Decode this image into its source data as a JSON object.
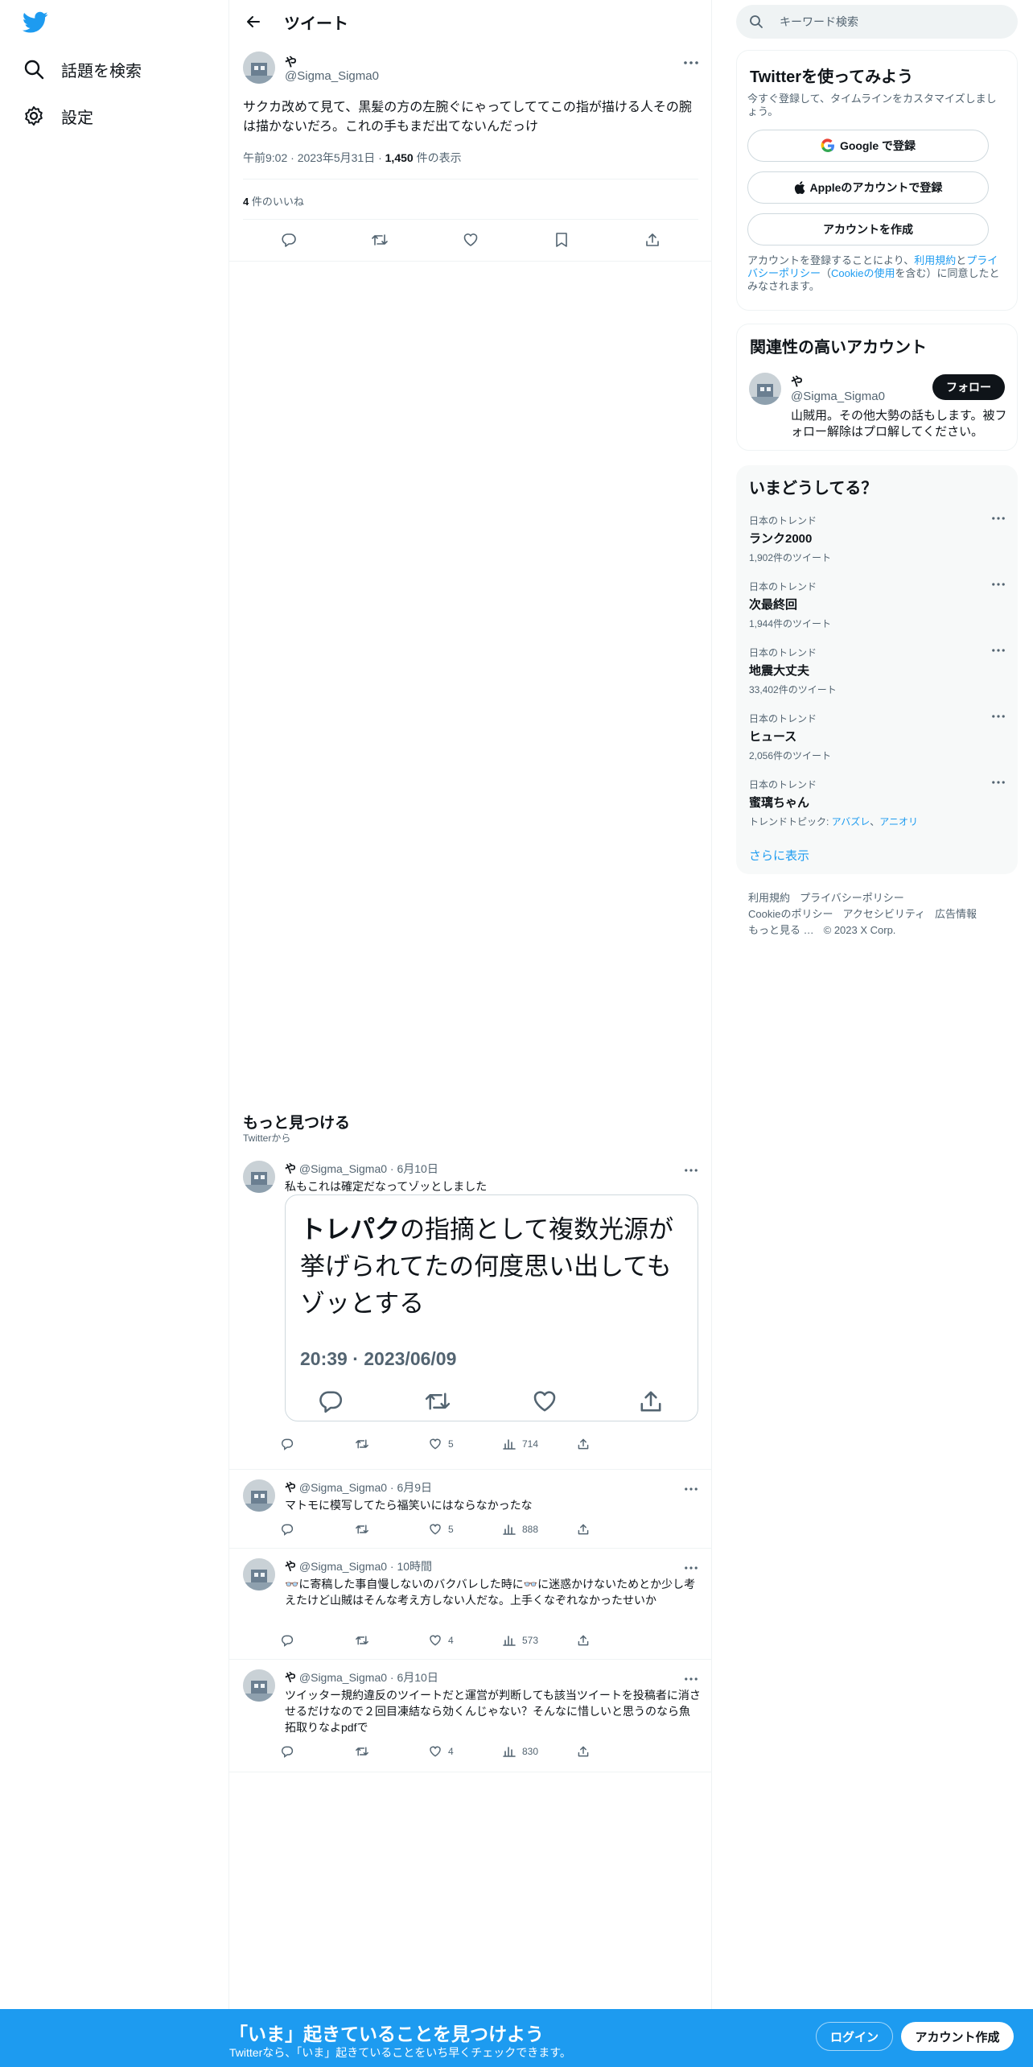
{
  "colors": {
    "brand": "#1d9bf0",
    "text": "#0f1419",
    "muted": "#536471",
    "border": "#eff3f4"
  },
  "nav": {
    "logo_icon": "twitter-bird-icon",
    "items": [
      {
        "icon": "search-icon",
        "label": "話題を検索"
      },
      {
        "icon": "gear-icon",
        "label": "設定"
      }
    ]
  },
  "header": {
    "title": "ツイート"
  },
  "main_tweet": {
    "name": "や",
    "handle": "@Sigma_Sigma0",
    "text": "サクカ改めて見て、黒髪の方の左腕ぐにゃってしててこの指が描ける人その腕は描かないだろ。これの手もまだ出てないんだっけ",
    "time": "午前9:02 · 2023年5月31日 · ",
    "views": "1,450",
    "views_label": " 件の表示",
    "likes": "4",
    "likes_label": " 件のいいね"
  },
  "more": {
    "title": "もっと見つける",
    "subtitle": "Twitterから"
  },
  "tweets": [
    {
      "name": "や",
      "meta": " @Sigma_Sigma0 · 6月10日",
      "text": "私もこれは確定だなってゾッとしました",
      "quote": {
        "bold": "トレパク",
        "text": "の指摘として複数光源が挙げられてたの何度思い出してもゾッとする",
        "time": "20:39 · 2023/06/09"
      },
      "likes": "5",
      "views": "714"
    },
    {
      "name": "や",
      "meta": " @Sigma_Sigma0 · 6月9日",
      "text": "マトモに模写してたら福笑いにはならなかったな",
      "likes": "5",
      "views": "888"
    },
    {
      "name": "や",
      "meta": " @Sigma_Sigma0 · 10時間",
      "text": "👓に寄稿した事自慢しないのバクバレした時に👓に迷惑かけないためとか少し考えたけど山賊はそんな考え方しない人だな。上手くなぞれなかったせいか",
      "likes": "4",
      "views": "573"
    },
    {
      "name": "や",
      "meta": " @Sigma_Sigma0 · 6月10日",
      "text": "ツイッター規約違反のツイートだと運営が判断しても該当ツイートを投稿者に消させるだけなので２回目凍結なら効くんじゃない？そんなに惜しいと思うのなら魚拓取りなよpdfで",
      "likes": "4",
      "views": "830"
    }
  ],
  "search": {
    "placeholder": "キーワード検索"
  },
  "signup_card": {
    "title": "Twitterを使ってみよう",
    "subtitle": "今すぐ登録して、タイムラインをカスタマイズしましょう。",
    "google": "Google で登録",
    "apple": "Appleのアカウントで登録",
    "create": "アカウントを作成",
    "legal_1": "アカウントを登録することにより、",
    "legal_terms": "利用規約",
    "legal_2": "と",
    "legal_privacy": "プライバシーポリシー",
    "legal_3": "（",
    "legal_cookie": "Cookieの使用",
    "legal_4": "を含む）に同意したとみなされます。"
  },
  "related": {
    "title": "関連性の高いアカウント",
    "name": "や",
    "handle": "@Sigma_Sigma0",
    "follow": "フォロー",
    "bio": "山賊用。その他大勢の話もします。被フォロー解除はプロ解してください。"
  },
  "trends": {
    "title": "いまどうしてる？",
    "items": [
      {
        "context": "日本のトレンド",
        "name": "ランク2000",
        "count": "1,902件のツイート"
      },
      {
        "context": "日本のトレンド",
        "name": "次最終回",
        "count": "1,944件のツイート"
      },
      {
        "context": "日本のトレンド",
        "name": "地震大丈夫",
        "count": "33,402件のツイート"
      },
      {
        "context": "日本のトレンド",
        "name": "ヒュース",
        "count": "2,056件のツイート"
      },
      {
        "context": "日本のトレンド",
        "name": "蜜璃ちゃん",
        "topic_label": "トレンドトピック: ",
        "topic_1": "アバズレ",
        "topic_sep": "、",
        "topic_2": "アニオリ"
      }
    ],
    "show_more": "さらに表示"
  },
  "footer": {
    "links": [
      "利用規約",
      "プライバシーポリシー",
      "Cookieのポリシー",
      "アクセシビリティ",
      "広告情報",
      "もっと見る …"
    ],
    "copyright": "© 2023 X Corp."
  },
  "banner": {
    "title": "「いま」起きていることを見つけよう",
    "subtitle": "Twitterなら、「いま」起きていることをいち早くチェックできます。",
    "login": "ログイン",
    "signup": "アカウント作成"
  }
}
